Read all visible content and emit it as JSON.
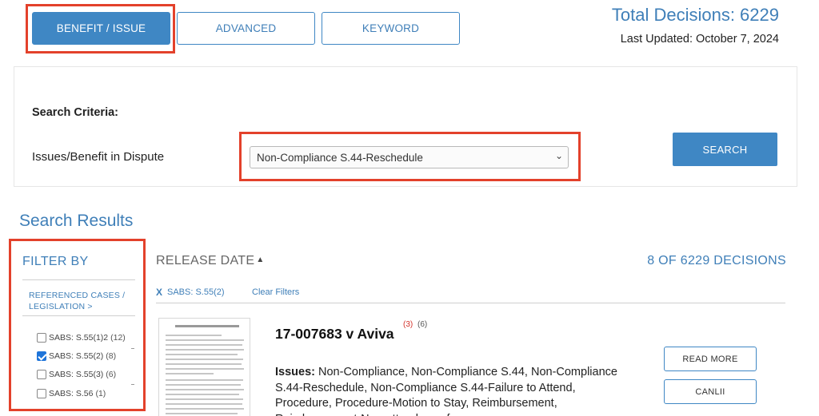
{
  "tabs": [
    {
      "label": "BENEFIT / ISSUE"
    },
    {
      "label": "ADVANCED"
    },
    {
      "label": "KEYWORD"
    }
  ],
  "stats": {
    "total_decisions": "Total Decisions: 6229",
    "last_updated": "Last Updated: October 7, 2024"
  },
  "criteria": {
    "title": "Search Criteria:",
    "issue_label": "Issues/Benefit in Dispute",
    "issue_selected": "Non-Compliance S.44-Reschedule",
    "search_label": "SEARCH"
  },
  "results": {
    "title": "Search Results",
    "sort_label": "RELEASE DATE",
    "count_label": "8 OF 6229 DECISIONS",
    "active_filter_x": "X",
    "active_filter": "SABS: S.55(2)",
    "clear_filters": "Clear Filters"
  },
  "filter": {
    "title": "FILTER BY",
    "group_label": "REFERENCED CASES / LEGISLATION >",
    "options": [
      {
        "label": "SABS: S.55(1)2",
        "count": "(12)",
        "checked": false
      },
      {
        "label": "SABS: S.55(2)",
        "count": "(8)",
        "checked": true
      },
      {
        "label": "SABS: S.55(3)",
        "count": "(6)",
        "checked": false
      },
      {
        "label": "SABS: S.56",
        "count": "(1)",
        "checked": false
      }
    ]
  },
  "decision": {
    "title": "17-007683 v Aviva",
    "citations_red": "(3)",
    "citations_gray": "(6)",
    "issues_label": "Issues:",
    "issues_text": "Non-Compliance, Non-Compliance S.44, Non-Compliance S.44-Reschedule, Non-Compliance S.44-Failure to Attend, Procedure, Procedure-Motion to Stay, Reimbursement, Reimbursement-Non-attendance fee",
    "read_more_label": "READ MORE",
    "canlii_label": "CANLII"
  },
  "colors": {
    "brand_blue": "#3f87c4",
    "link_blue": "#3f7fb8",
    "highlight_red": "#e3412b"
  }
}
